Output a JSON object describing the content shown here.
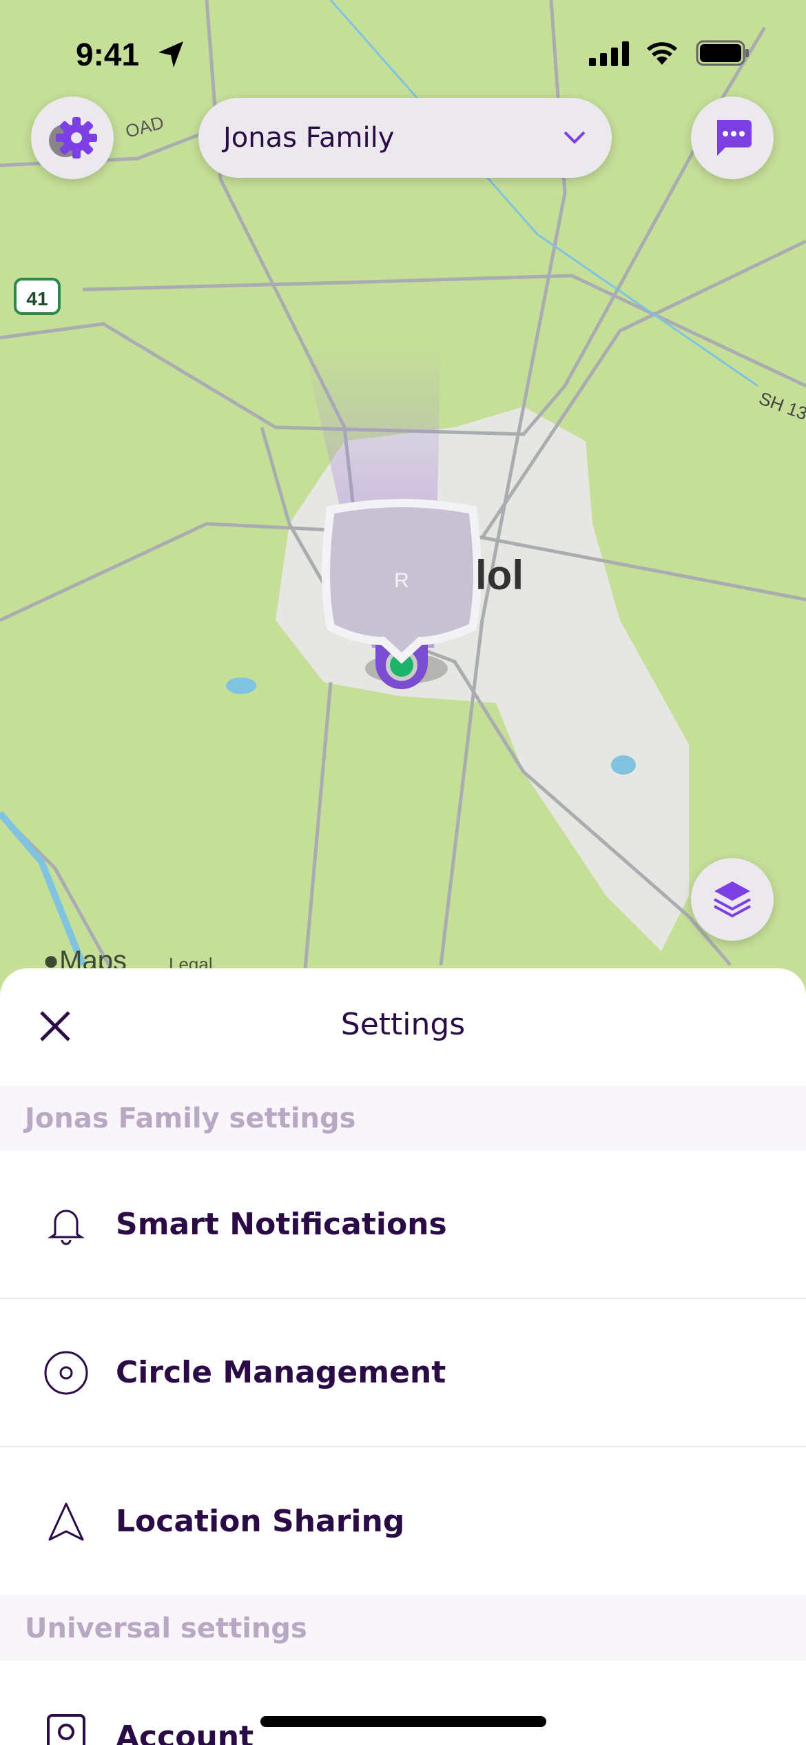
{
  "status_bar": {
    "time": "9:41"
  },
  "map": {
    "circle_selector": {
      "label": "Jonas Family"
    },
    "road_label": "OAD",
    "highway_shield": "41",
    "highway_label": "SH 13",
    "place_label": "lol",
    "avatar_initial": "R",
    "attribution": {
      "brand": "Maps",
      "legal": "Legal"
    }
  },
  "colors": {
    "accent": "#7b3fe4",
    "text_dark": "#2a0b45",
    "section_text": "#b9a8c4",
    "online": "#1db36a"
  },
  "settings": {
    "title": "Settings",
    "sections": [
      {
        "header": "Jonas Family settings",
        "items": [
          {
            "label": "Smart Notifications",
            "icon": "bell-icon"
          },
          {
            "label": "Circle Management",
            "icon": "circle-target-icon"
          },
          {
            "label": "Location Sharing",
            "icon": "navigation-arrow-icon"
          }
        ]
      },
      {
        "header": "Universal settings",
        "items": [
          {
            "label": "Account",
            "icon": "account-icon"
          }
        ]
      }
    ]
  }
}
